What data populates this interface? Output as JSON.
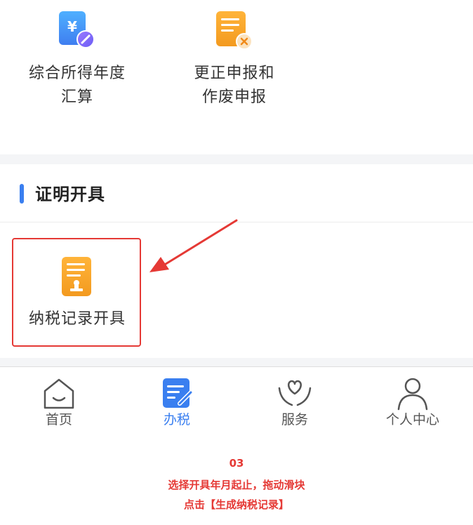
{
  "tiles_top": [
    {
      "label_line1": "综合所得年度",
      "label_line2": "汇算",
      "icon": "yuan-edit-icon"
    },
    {
      "label_line1": "更正申报和",
      "label_line2": "作废申报",
      "icon": "document-cancel-icon"
    }
  ],
  "section": {
    "title": "证明开具"
  },
  "tiles_cert": [
    {
      "label": "纳税记录开具",
      "icon": "tax-certificate-icon"
    }
  ],
  "bottom_nav": [
    {
      "label": "首页",
      "icon": "home-icon",
      "active": false
    },
    {
      "label": "办税",
      "icon": "tax-handle-icon",
      "active": true
    },
    {
      "label": "服务",
      "icon": "service-heart-icon",
      "active": false
    },
    {
      "label": "个人中心",
      "icon": "person-icon",
      "active": false
    }
  ],
  "caption": {
    "step": "03",
    "line1": "选择开具年月起止，拖动滑块",
    "line2": "点击【生成纳税记录】"
  },
  "colors": {
    "accent": "#3a7ff0",
    "highlight": "#e53935",
    "icon_orange": "#f5a623"
  }
}
